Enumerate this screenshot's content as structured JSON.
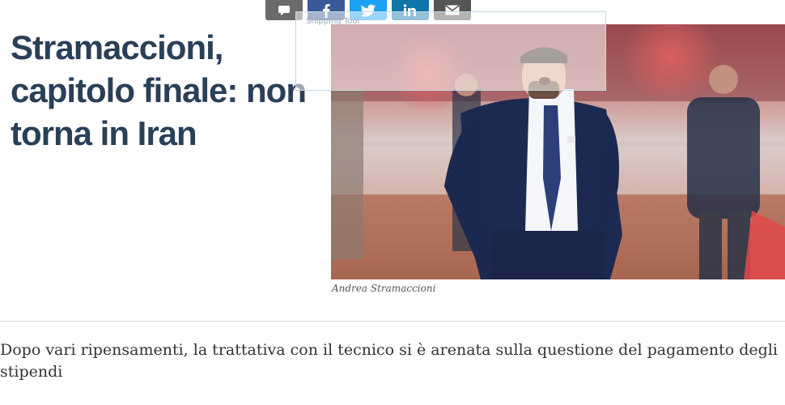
{
  "share_bar": {
    "buttons": [
      {
        "name": "comment",
        "icon": "comment-icon",
        "color": "#6b6b6b"
      },
      {
        "name": "facebook",
        "icon": "facebook-icon",
        "color": "#3b5998"
      },
      {
        "name": "twitter",
        "icon": "twitter-icon",
        "color": "#1da1f2"
      },
      {
        "name": "linkedin",
        "icon": "linkedin-icon",
        "color": "#0e76a8"
      },
      {
        "name": "email",
        "icon": "mail-icon",
        "color": "#555555"
      }
    ]
  },
  "article": {
    "headline": "Stramaccioni, capitolo finale: non torna in Iran",
    "photo_caption": "Andrea Stramaccioni",
    "summary": "Dopo vari ripensamenti, la trattativa con il tecnico si è arenata sulla questione del pagamento degli stipendi"
  },
  "overlay": {
    "label": "Snipping Tool"
  },
  "colors": {
    "headline": "#2a3f58",
    "summary": "#333333",
    "caption": "#555555"
  }
}
